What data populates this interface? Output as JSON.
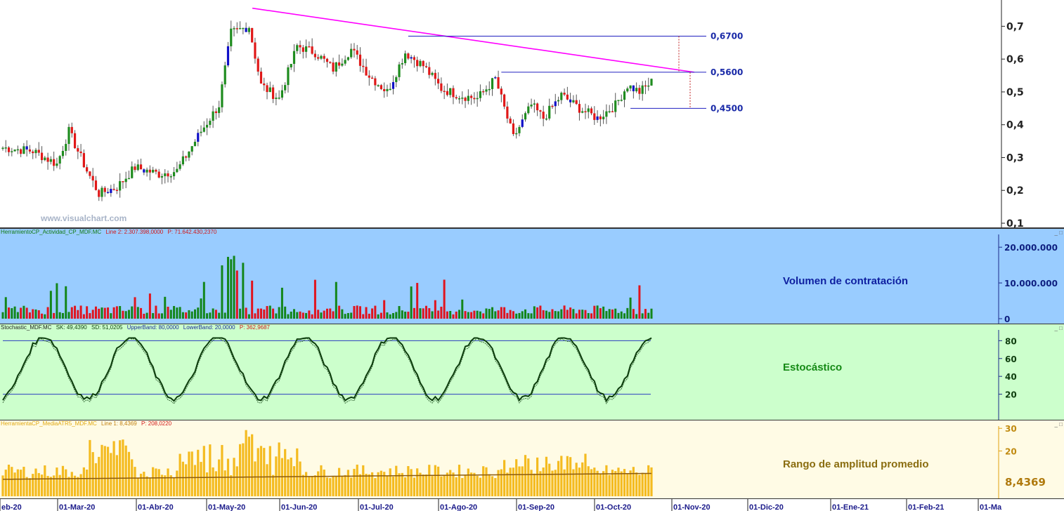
{
  "chart_data": [
    {
      "type": "candlestick",
      "title": "",
      "watermark": "www.visualchart.com",
      "y_ticks": [
        "0,7",
        "0,6",
        "0,5",
        "0,4",
        "0,3",
        "0,2",
        "0,1"
      ],
      "ylim": [
        0.1,
        0.78
      ],
      "levels": [
        {
          "label": "0,6700",
          "value": 0.67
        },
        {
          "label": "0,5600",
          "value": 0.56
        },
        {
          "label": "0,4500",
          "value": 0.45
        }
      ],
      "trendline": {
        "from": {
          "date": "2020-05-01",
          "value": 0.755
        },
        "to": {
          "date": "2020-10-20",
          "value": 0.56
        }
      },
      "colors": {
        "up": "#1f8c1f",
        "down": "#e01818",
        "doji": "#1010c8",
        "trend": "#ff00ff",
        "level": "#2020c0"
      }
    },
    {
      "type": "bar",
      "header": {
        "name": "HerramientoCP_Actividad_CP_MDF.MC",
        "line": "Line 2: 2.307.398,0000",
        "price": "P: 71.642.430,2370"
      },
      "label": "Volumen de contratación",
      "y_ticks": [
        "20.000.000",
        "10.000.000",
        "0"
      ],
      "ylim": [
        0,
        22000000
      ],
      "colors": {
        "up": "#13861a",
        "down": "#e0141e",
        "background": "#99ccff"
      }
    },
    {
      "type": "line",
      "header": {
        "name": "Stochastic_MDF.MC",
        "sk": "SK: 49,4390",
        "sd": "SD: 51,0205",
        "upper": "UpperBand: 80,0000",
        "lower": "LowerBand: 20,0000",
        "price": "P: 362,9687"
      },
      "label": "Estocástico",
      "y_ticks": [
        "80",
        "60",
        "40",
        "20"
      ],
      "ylim": [
        0,
        85
      ],
      "bands": [
        80,
        20
      ],
      "colors": {
        "line": "#0d3d0d",
        "band": "#2a3dbf",
        "background": "#ccffcc"
      }
    },
    {
      "type": "bar",
      "header": {
        "name": "HerramientaCP_MediaATR5_MDF.MC",
        "line": "Line 1: 8,4369",
        "price": "P: 208,0220"
      },
      "label": "Rango de amplitud promedio",
      "y_ticks": [
        "30",
        "20"
      ],
      "last_value": "8,4369",
      "ylim": [
        0,
        31
      ],
      "colors": {
        "bar": "#f4bb20",
        "avg": "#8b5a0d",
        "background": "#fffbe5"
      }
    }
  ],
  "x_axis": {
    "labels": [
      "eb-20",
      "01-Mar-20",
      "01-Abr-20",
      "01-May-20",
      "01-Jun-20",
      "01-Jul-20",
      "01-Ago-20",
      "01-Sep-20",
      "01-Oct-20",
      "01-Nov-20",
      "01-Dic-20",
      "01-Ene-21",
      "01-Feb-21",
      "01-Ma"
    ],
    "year_label": "2021"
  }
}
